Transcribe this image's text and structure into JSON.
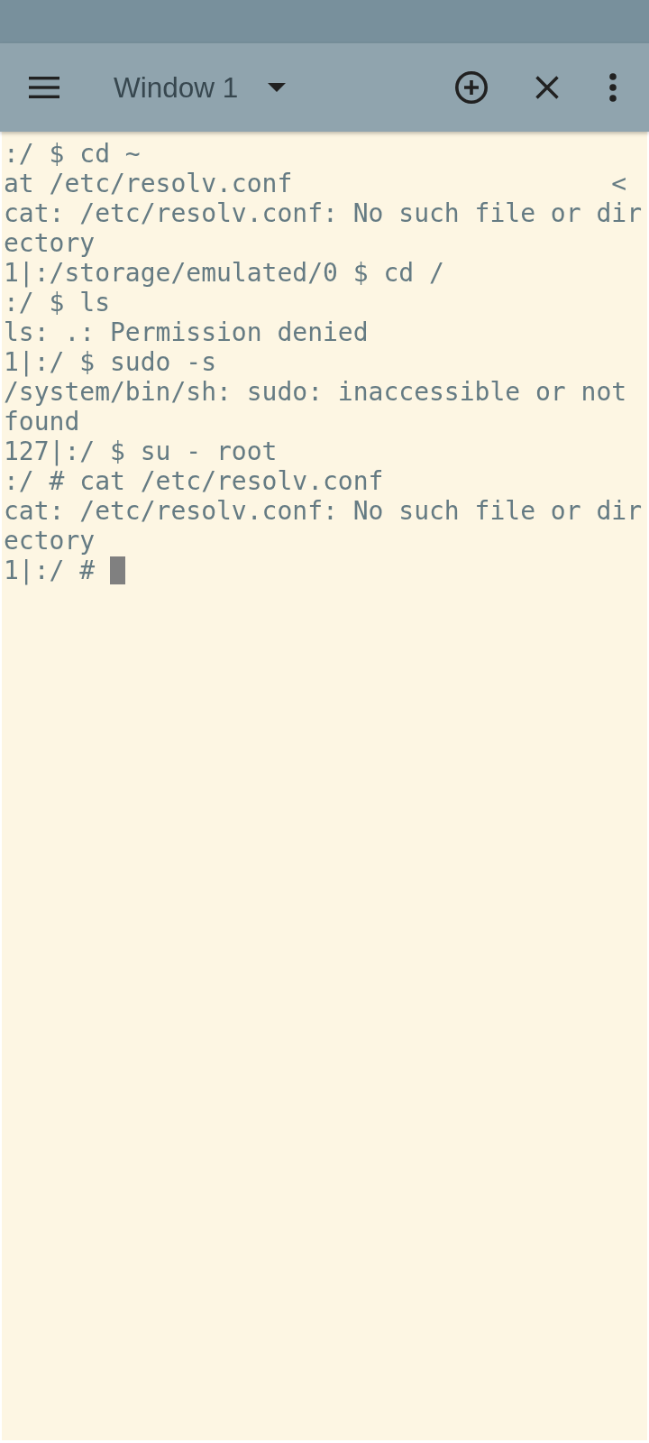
{
  "toolbar": {
    "window_title": "Window 1"
  },
  "terminal": {
    "lines": [
      {
        "text": ":/ $ cd ~",
        "cursor": false
      },
      {
        "text": "at /etc/resolv.conf                     <",
        "cursor": false
      },
      {
        "text": "cat: /etc/resolv.conf: No such file or dir",
        "cursor": false
      },
      {
        "text": "ectory",
        "cursor": false
      },
      {
        "text": "1|:/storage/emulated/0 $ cd /",
        "cursor": false
      },
      {
        "text": ":/ $ ls",
        "cursor": false
      },
      {
        "text": "ls: .: Permission denied",
        "cursor": false
      },
      {
        "text": "1|:/ $ sudo -s",
        "cursor": false
      },
      {
        "text": "/system/bin/sh: sudo: inaccessible or not",
        "cursor": false
      },
      {
        "text": "found",
        "cursor": false
      },
      {
        "text": "127|:/ $ su - root",
        "cursor": false
      },
      {
        "text": ":/ # cat /etc/resolv.conf",
        "cursor": false
      },
      {
        "text": "cat: /etc/resolv.conf: No such file or dir",
        "cursor": false
      },
      {
        "text": "ectory",
        "cursor": false
      },
      {
        "text": "1|:/ #",
        "cursor": true
      }
    ]
  }
}
